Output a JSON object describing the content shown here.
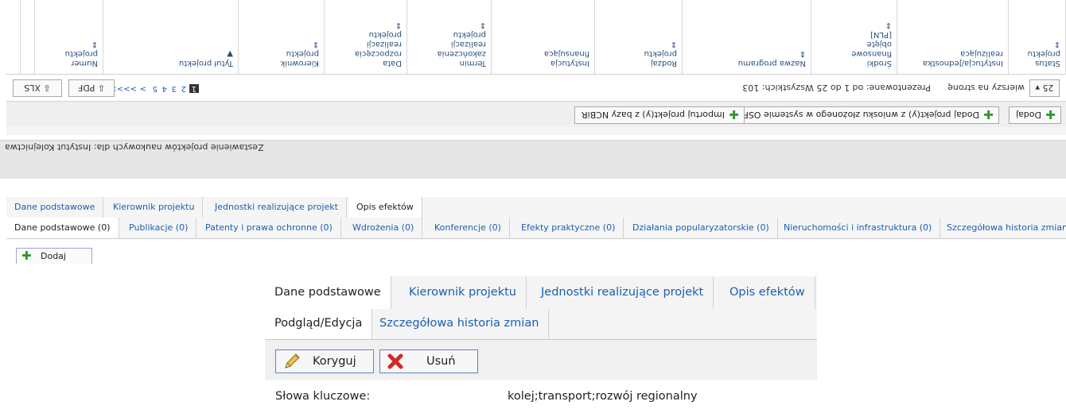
{
  "grid": {
    "toolbar": {
      "add": "Dodaj",
      "add_from_osf": "Dodaj projekt(y) z wniosku złożonego w systemie OSF",
      "import_ncbir": "Importuj projekt(y) z bazy NCBiR"
    },
    "pager": {
      "page_size": "25",
      "rows_per_page_label": "wierszy na stronę",
      "range_text": "Prezentowane: od 1 do 25 Wszystkich: 103",
      "pages": [
        "1",
        "2",
        "3",
        "4",
        "5",
        ">",
        ">>>>"
      ],
      "pdf": "PDF",
      "xls": "XLS"
    },
    "columns": [
      {
        "lines": [
          "Numer",
          "projektu"
        ],
        "sort": "⇕"
      },
      {
        "lines": [
          "Tytuł projektu"
        ],
        "sort": "▼"
      },
      {
        "lines": [
          "Kierownik",
          "projektu"
        ],
        "sort": "⇕"
      },
      {
        "lines": [
          "Data",
          "rozpoczęcia",
          "realizacji",
          "projektu"
        ],
        "sort": "⇕"
      },
      {
        "lines": [
          "Termin",
          "zakończenia",
          "realizacji",
          "projektu"
        ],
        "sort": "⇕"
      },
      {
        "lines": [
          "Instytucja",
          "finansująca"
        ],
        "sort": ""
      },
      {
        "lines": [
          "Rodzaj",
          "projektu"
        ],
        "sort": "⇕"
      },
      {
        "lines": [
          "Nazwa programu"
        ],
        "sort": "⇕"
      },
      {
        "lines": [
          "Środki",
          "finansowe",
          "objęte",
          "[PLN]"
        ],
        "sort": "⇕"
      },
      {
        "lines": [
          "Instytucja/Jednostka",
          "realizująca"
        ],
        "sort": ""
      },
      {
        "lines": [
          "Status",
          "projektu"
        ],
        "sort": "⇕"
      }
    ]
  },
  "strip": {
    "title": "Zestawienie projektów naukowych dla: Instytut Kolejnictwa"
  },
  "panel_small": {
    "main_tabs": [
      "Dane podstawowe",
      "Kierownik projektu",
      "Jednostki realizujące projekt",
      "Opis efektów"
    ],
    "sub_tabs": [
      "Dane podstawowe (0)",
      "Publikacje (0)",
      "Patenty i prawa ochronne (0)",
      "Wdrożenia (0)",
      "Konferencje (0)",
      "Efekty praktyczne (0)",
      "Działania popularyzatorskie (0)",
      "Nieruchomości i infrastruktura (0)",
      "Szczegółowa historia zmian"
    ],
    "add_button": "Dodaj"
  },
  "panel_large": {
    "main_tabs": [
      "Dane podstawowe",
      "Kierownik projektu",
      "Jednostki realizujące projekt",
      "Opis efektów"
    ],
    "sub_tabs": [
      "Podgląd/Edycja",
      "Szczegółowa historia zmian"
    ],
    "edit_button": "Koryguj",
    "delete_button": "Usuń",
    "keywords_label": "Słowa kluczowe:",
    "keywords_value": "kolej;transport;rozwój regionalny"
  },
  "colors": {
    "link": "#1a5fb4",
    "button_border": "#5e86b8",
    "add_green": "#2e9a2e",
    "delete_red": "#d12a2a"
  }
}
